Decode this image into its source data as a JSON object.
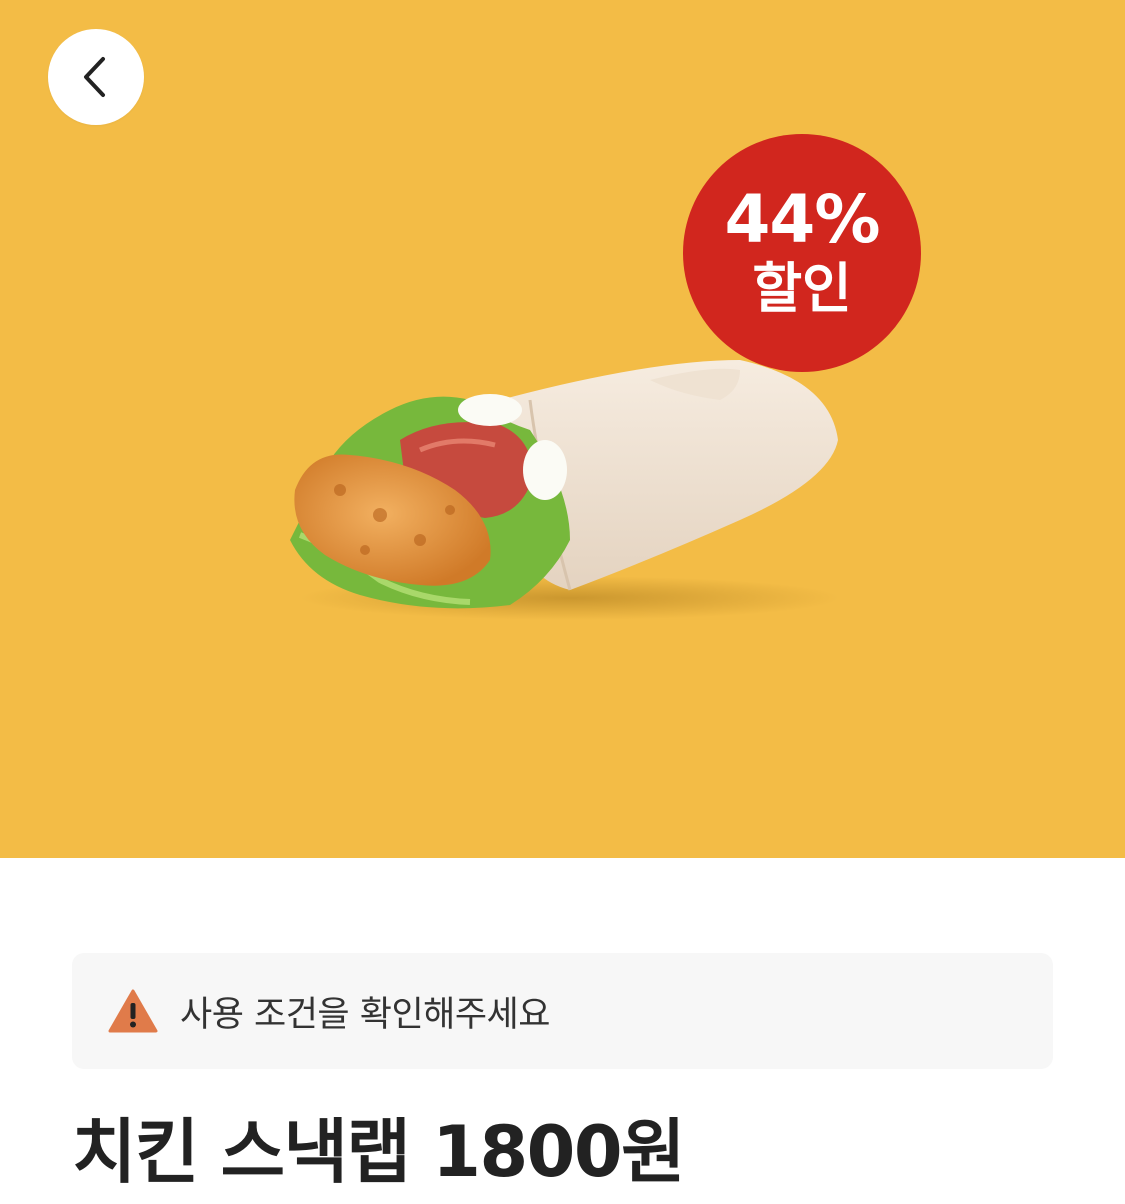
{
  "hero": {
    "background_color": "#f3bc46",
    "back_icon": "chevron-left-icon",
    "badge": {
      "percent": "44%",
      "word": "할인",
      "color": "#d1261e"
    },
    "product_image": "chicken-snack-wrap"
  },
  "notice": {
    "icon": "warning-icon",
    "icon_color": "#e07b4a",
    "text": "사용 조건을 확인해주세요"
  },
  "product": {
    "title": "치킨 스낵랩 1800원"
  }
}
